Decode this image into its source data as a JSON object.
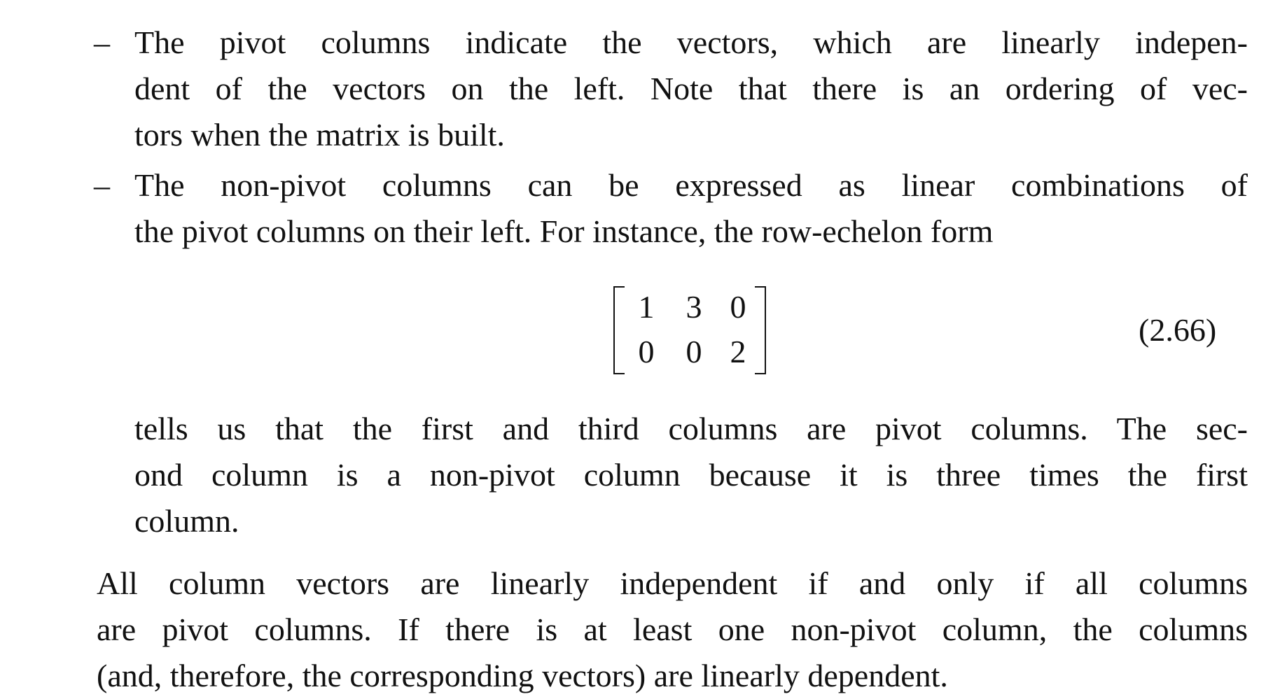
{
  "bullets": [
    {
      "dash": "–",
      "lines": [
        "The pivot columns indicate the vectors, which are linearly indepen-",
        "dent of the vectors on the left. Note that there is an ordering of vec-",
        "tors when the matrix is built."
      ]
    },
    {
      "dash": "–",
      "lines": [
        "The non-pivot columns can be expressed as linear combinations of",
        "the pivot columns on their left. For instance, the row-echelon form"
      ]
    }
  ],
  "matrix": {
    "rows": [
      [
        "1",
        "3",
        "0"
      ],
      [
        "0",
        "0",
        "2"
      ]
    ],
    "equation_number": "(2.66)"
  },
  "continuation": {
    "lines": [
      "tells us that the first and third columns are pivot columns. The sec-",
      "ond column is a non-pivot column because it is three times the first",
      "column."
    ]
  },
  "final_paragraph": {
    "lines": [
      "All column vectors are linearly independent if and only if all columns",
      "are pivot columns. If there is at least one non-pivot column, the columns",
      "(and, therefore, the corresponding vectors) are linearly dependent."
    ]
  }
}
